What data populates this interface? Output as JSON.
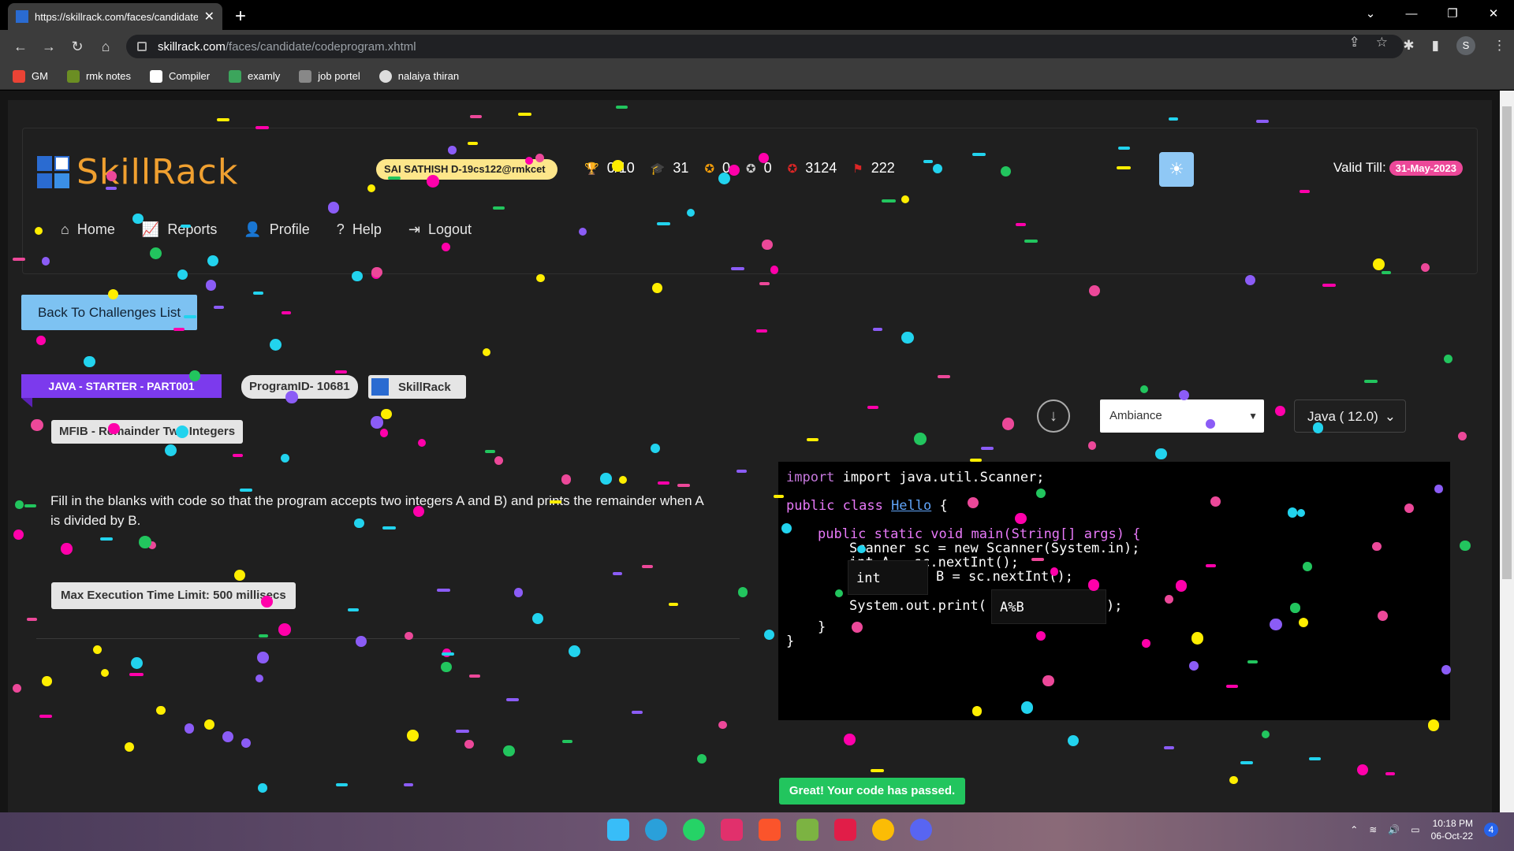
{
  "browser": {
    "tab_title": "https://skillrack.com/faces/candidate",
    "url_domain": "skillrack.com",
    "url_path": "/faces/candidate/codeprogram.xhtml",
    "profile_initial": "S"
  },
  "bookmarks": [
    {
      "label": "GM",
      "color": "#ea4335"
    },
    {
      "label": "rmk notes",
      "color": "#6b8e23"
    },
    {
      "label": "Compiler",
      "color": "#ffffff"
    },
    {
      "label": "examly",
      "color": "#3ca55c"
    },
    {
      "label": "job portel",
      "color": "#888888"
    },
    {
      "label": "nalaiya thiran",
      "color": "#dddddd"
    }
  ],
  "header": {
    "logo_text": "SkillRack",
    "user": "SAI SATHISH D-19cs122@rmkcet",
    "stats": [
      {
        "icon": "trophy-icon",
        "value": "0/10"
      },
      {
        "icon": "graduation-cap-icon",
        "value": "31"
      },
      {
        "icon": "gold-medal-icon",
        "value": "0"
      },
      {
        "icon": "silver-medal-icon",
        "value": "0"
      },
      {
        "icon": "bronze-medal-icon",
        "value": "3124"
      },
      {
        "icon": "flag-icon",
        "value": "222"
      }
    ],
    "valid_label": "Valid Till:",
    "valid_date": "31-May-2023"
  },
  "nav": [
    {
      "icon": "home-icon",
      "label": "Home"
    },
    {
      "icon": "chart-icon",
      "label": "Reports"
    },
    {
      "icon": "user-icon",
      "label": "Profile"
    },
    {
      "icon": "help-icon",
      "label": "Help"
    },
    {
      "icon": "logout-icon",
      "label": "Logout"
    }
  ],
  "back_button": "Back To Challenges List",
  "problem": {
    "ribbon": "JAVA - STARTER - PART001",
    "program_id": "ProgramID- 10681",
    "source": "SkillRack",
    "title": "MFIB - Remainder Two Integers",
    "description": "Fill in the blanks with code so that the program accepts two integers A and B) and prints the remainder when A is divided by B.",
    "max_time": "Max Execution Time Limit: 500 millisecs"
  },
  "editor": {
    "theme": "Ambiance",
    "language": "Java ( 12.0)",
    "lines": {
      "l1": "import java.util.Scanner;",
      "l2a": "public class ",
      "l2b": "Hello",
      "l2c": " {",
      "l3": "public static void main(String[] args) {",
      "l4": "Scanner sc = new Scanner(System.in);",
      "l5": "int A = sc.nextInt();",
      "l6": "B = sc.nextInt();",
      "l7a": "System.out.print(",
      "l7b": ");",
      "l8": "}",
      "l9": "}"
    },
    "blank1": "int",
    "blank2": "A%B"
  },
  "result": "Great! Your code has passed.",
  "taskbar": {
    "time": "10:18 PM",
    "date": "06-Oct-22",
    "notif": "4"
  }
}
